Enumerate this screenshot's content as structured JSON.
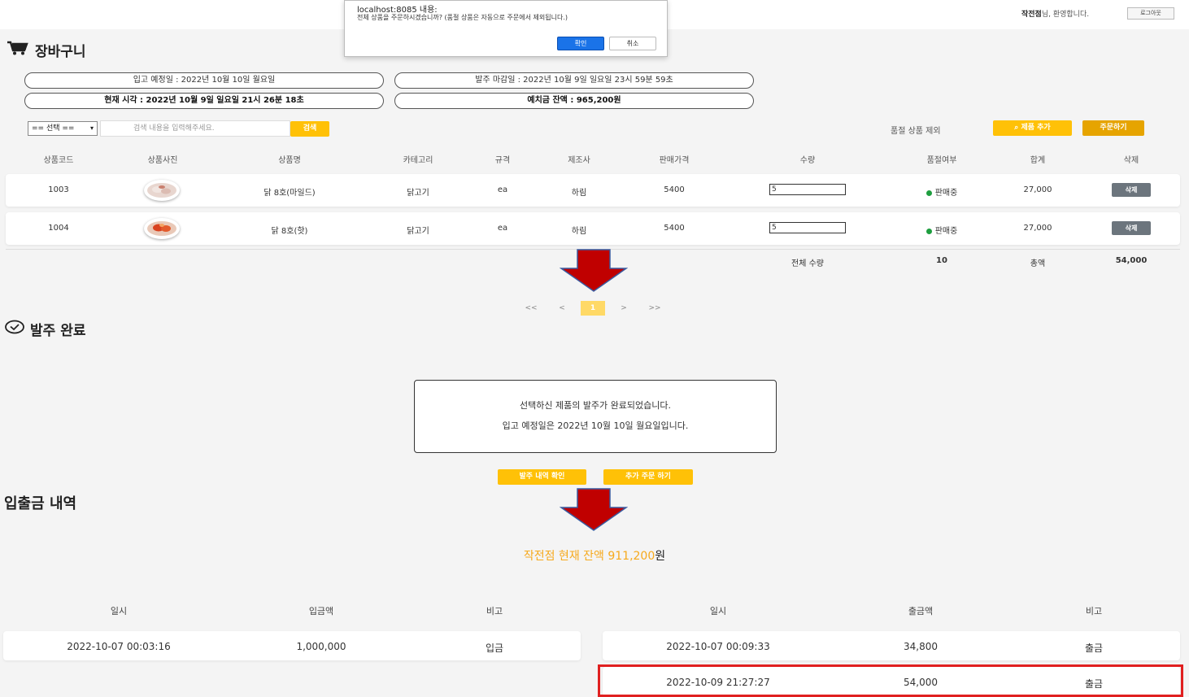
{
  "header": {
    "user_name": "작전점",
    "welcome_suffix": "님, 환영합니다.",
    "logout_label": "로그아웃"
  },
  "dialog": {
    "title": "localhost:8085 내용:",
    "message": "전체 상품을 주문하시겠습니까? (품절 상품은 자동으로 주문에서 제외됩니다.)",
    "ok_label": "확인",
    "cancel_label": "취소"
  },
  "cart": {
    "title": "장바구니",
    "arrival_date": "입고 예정일 : 2022년 10월 10일 월요일",
    "deadline": "발주 마감일 : 2022년 10월 9일 일요일 23시 59분 59초",
    "current_time": "현재 시각 : 2022년 10월 9일 일요일 21시 26분 18초",
    "deposit_balance": "예치금 잔액 : 965,200원",
    "select_value": "== 선택 ==",
    "search_placeholder": "검색 내용을 입력해주세요.",
    "search_button": "검색",
    "exclude_soldout_label": "품절 상품 제외",
    "add_product_button": "제품 추가",
    "order_button": "주문하기",
    "columns": [
      "상품코드",
      "상품사진",
      "상품명",
      "카테고리",
      "규격",
      "제조사",
      "판매가격",
      "수량",
      "품절여부",
      "합계",
      "삭제"
    ],
    "rows": [
      {
        "code": "1003",
        "name": "닭 8호(마일드)",
        "category": "닭고기",
        "spec": "ea",
        "maker": "하림",
        "price": "5400",
        "qty": "5",
        "status": "판매중",
        "total": "27,000",
        "delete": "삭제"
      },
      {
        "code": "1004",
        "name": "닭 8호(핫)",
        "category": "닭고기",
        "spec": "ea",
        "maker": "하림",
        "price": "5400",
        "qty": "5",
        "status": "판매중",
        "total": "27,000",
        "delete": "삭제"
      }
    ],
    "summary": {
      "qty_label": "전체 수량",
      "qty_value": "10",
      "amount_label": "총액",
      "amount_value": "54,000"
    },
    "pagination": [
      "<<",
      "<",
      "1",
      ">",
      ">>"
    ]
  },
  "order_complete": {
    "title": "발주 완료",
    "line1": "선택하신 제품의 발주가 완료되었습니다.",
    "line2": "입고 예정일은 2022년 10월 10일 월요일입니다.",
    "history_button": "발주 내역 확인",
    "more_button": "추가 주문 하기"
  },
  "ledger": {
    "title": "입출금 내역",
    "balance_text": "작전점 현재 잔액 911,200",
    "balance_unit": "원",
    "deposit_columns": [
      "일시",
      "입금액",
      "비고"
    ],
    "withdraw_columns": [
      "일시",
      "출금액",
      "비고"
    ],
    "deposits": [
      {
        "date": "2022-10-07 00:03:16",
        "amount": "1,000,000",
        "note": "입금"
      }
    ],
    "withdrawals": [
      {
        "date": "2022-10-07 00:09:33",
        "amount": "34,800",
        "note": "출금"
      },
      {
        "date": "2022-10-09 21:27:27",
        "amount": "54,000",
        "note": "출금"
      }
    ]
  },
  "colors": {
    "accent": "#ffc107",
    "accent_dark": "#e6a400",
    "balance_text": "#f6a91c",
    "arrow": "#c00000",
    "highlight": "#e02020"
  }
}
